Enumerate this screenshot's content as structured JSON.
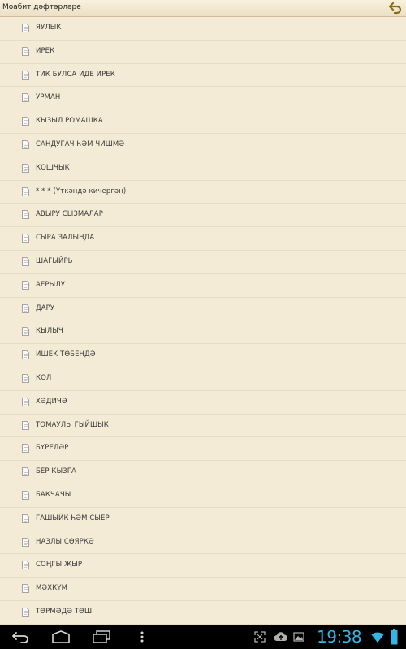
{
  "app": {
    "title": "Моабит дәфтәрләре"
  },
  "poems": [
    "ЯУЛЫК",
    "ИРЕК",
    "ТИК БУЛСА ИДЕ ИРЕК",
    "УРМАН",
    "КЫЗЫЛ РОМАШКА",
    "САНДУГАЧ ҺӘМ ЧИШМӘ",
    "КОШЧЫК",
    "* * * (Үткәндә кичергән)",
    "АВЫРУ СЫЗМАЛАР",
    "СЫРА ЗАЛЫНДА",
    "ШАГЫЙРЬ",
    "АЕРЫЛУ",
    "ДАРУ",
    "КЫЛЫЧ",
    "ИШЕК ТӨБЕНДӘ",
    "КОЛ",
    "ХӘДИЧӘ",
    "ТОМАУЛЫ ГЫЙШЫК",
    "БҮРЕЛӘР",
    "БЕР КЫЗГА",
    "БАКЧАЧЫ",
    "ГАШЫЙК ҺӘМ СЫЕР",
    "НАЗЛЫ СӨЯРКӘ",
    "СОҢГЫ ҖЫР",
    "МӘХКҮМ",
    "ТӨРМӘДӘ ТӨШ"
  ],
  "status": {
    "time": "19:38"
  },
  "icons": {
    "back": "back-arrow-icon",
    "doc": "document-icon",
    "nav": [
      "back-icon",
      "home-icon",
      "recent-apps-icon",
      "menu-icon"
    ],
    "status": [
      "fullscreen-icon",
      "upload-icon",
      "image-icon",
      "wifi-icon",
      "battery-icon"
    ]
  },
  "colors": {
    "background": "#f4ebd6",
    "clock": "#33b5e5",
    "back_icon": "#8a6a1e"
  }
}
